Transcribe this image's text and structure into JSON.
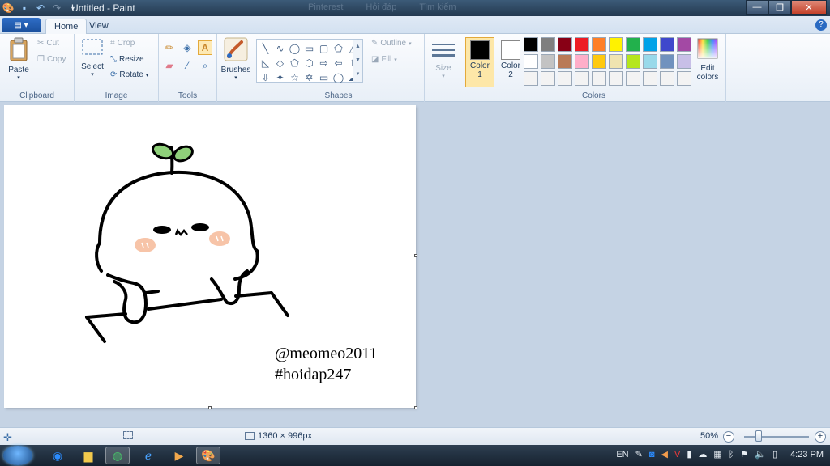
{
  "window": {
    "title": "Untitled - Paint",
    "background_tabs": [
      "Pinterest",
      "Hỏi đáp",
      "Tìm kiếm"
    ]
  },
  "quick_access": {
    "icons": [
      "paint-app-icon",
      "save-icon",
      "undo-icon",
      "redo-icon",
      "customize-icon"
    ]
  },
  "window_controls": {
    "minimize": "—",
    "maximize": "❐",
    "close": "✕"
  },
  "ribbon_tabs": {
    "menu_glyph": "▤ ▾",
    "home": "Home",
    "view": "View",
    "help": "?"
  },
  "clipboard": {
    "paste": "Paste",
    "cut": "Cut",
    "copy": "Copy",
    "group": "Clipboard"
  },
  "image": {
    "select": "Select",
    "crop": "Crop",
    "resize": "Resize",
    "rotate": "Rotate",
    "group": "Image"
  },
  "tools": {
    "group": "Tools",
    "items": [
      "pencil",
      "fill",
      "text",
      "eraser",
      "color-picker",
      "magnifier"
    ],
    "text_glyph": "A",
    "selected": "text"
  },
  "brushes": {
    "label": "Brushes"
  },
  "shapes": {
    "group": "Shapes",
    "outline": "Outline",
    "fill": "Fill",
    "glyphs": [
      "╲",
      "∿",
      "◯",
      "▭",
      "▢",
      "⬠",
      "△",
      "◺",
      "◇",
      "⬠",
      "⬡",
      "⇨",
      "⇦",
      "⇧",
      "⇩",
      "✦",
      "☆",
      "✡",
      "▭",
      "◯",
      "☁"
    ]
  },
  "size": {
    "label": "Size"
  },
  "colors": {
    "group": "Colors",
    "color1_label": "Color 1",
    "color1_line1": "Color",
    "color1_line2": "1",
    "color1": "#000000",
    "color2_line1": "Color",
    "color2_line2": "2",
    "color2": "#ffffff",
    "edit_line1": "Edit",
    "edit_line2": "colors",
    "palette": [
      "#000000",
      "#7f7f7f",
      "#880015",
      "#ed1c24",
      "#ff7f27",
      "#fff200",
      "#22b14c",
      "#00a2e8",
      "#3f48cc",
      "#a349a4",
      "#ffffff",
      "#c3c3c3",
      "#b97a57",
      "#ffaec9",
      "#ffc90e",
      "#efe4b0",
      "#b5e61d",
      "#99d9ea",
      "#7092be",
      "#c8bfe7",
      "#f3f3f3",
      "#f3f3f3",
      "#f3f3f3",
      "#f3f3f3",
      "#f3f3f3",
      "#f3f3f3",
      "#f3f3f3",
      "#f3f3f3",
      "#f3f3f3",
      "#f3f3f3"
    ]
  },
  "canvas": {
    "line1": "@meomeo2011",
    "line2": "#hoidap247",
    "sprout_color": "#8fd17a",
    "cheek_color": "#f7c4a8"
  },
  "status": {
    "dimensions": "1360 × 996px",
    "zoom": "50%",
    "zoom_fraction": 0.5
  },
  "taskbar": {
    "apps": [
      "zalo-icon",
      "file-explorer-icon",
      "chrome-icon",
      "ie-icon",
      "media-player-icon",
      "paint-icon"
    ],
    "language": "EN",
    "time": "4:23 PM"
  }
}
